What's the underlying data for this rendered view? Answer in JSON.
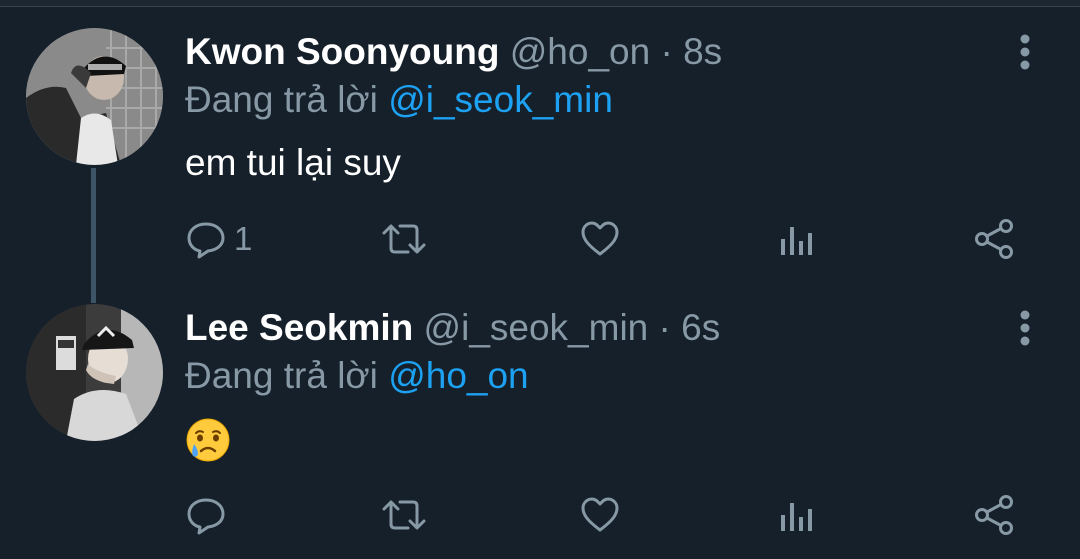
{
  "tweets": [
    {
      "display_name": "Kwon Soonyoung",
      "handle": "@ho_on",
      "separator": "·",
      "time": "8s",
      "reply_prefix": "Đang trả lời",
      "reply_to": "@i_seok_min",
      "text": "em tui lại suy",
      "reply_count": "1",
      "avatar_icon": "avatar-photo"
    },
    {
      "display_name": "Lee Seokmin",
      "handle": "@i_seok_min",
      "separator": "·",
      "time": "6s",
      "reply_prefix": "Đang trả lời",
      "reply_to": "@ho_on",
      "emoji": "crying-face",
      "reply_count": "",
      "avatar_icon": "avatar-photo"
    }
  ],
  "colors": {
    "background": "#15202b",
    "primary_text": "#ffffff",
    "secondary_text": "#8899a6",
    "accent": "#1da1f2",
    "thread_line": "#3d5466"
  },
  "icons": [
    "reply-icon",
    "retweet-icon",
    "like-icon",
    "analytics-icon",
    "share-icon",
    "more-icon"
  ]
}
